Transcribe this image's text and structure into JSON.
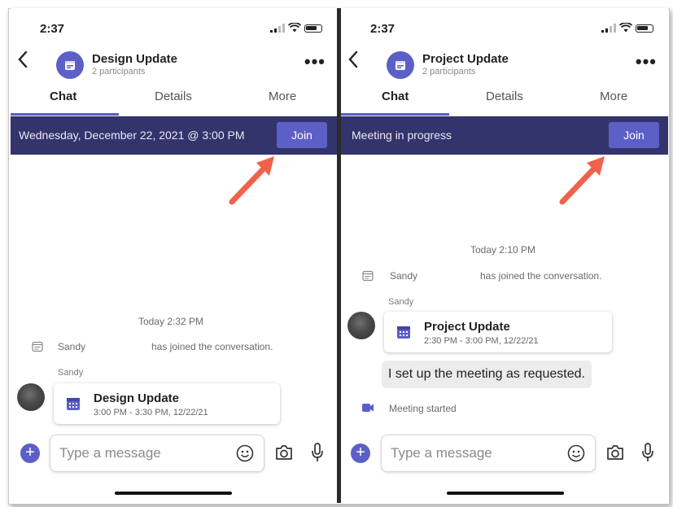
{
  "screens": [
    {
      "status_time": "2:37",
      "chat_title": "Design Update",
      "participants": "2 participants",
      "tabs": [
        "Chat",
        "Details",
        "More"
      ],
      "banner_text": "Wednesday, December 22, 2021 @ 3:00 PM",
      "join_label": "Join",
      "timestamp": "Today 2:32 PM",
      "system_message": {
        "name": "Sandy",
        "text": "has joined the conversation."
      },
      "sender_name": "Sandy",
      "meeting_card": {
        "title": "Design Update",
        "time": "3:00 PM - 3:30 PM, 12/22/21"
      },
      "composer_placeholder": "Type a message"
    },
    {
      "status_time": "2:37",
      "chat_title": "Project Update",
      "participants": "2 participants",
      "tabs": [
        "Chat",
        "Details",
        "More"
      ],
      "banner_text": "Meeting in progress",
      "join_label": "Join",
      "timestamp": "Today 2:10 PM",
      "system_message": {
        "name": "Sandy",
        "text": "has joined the conversation."
      },
      "sender_name": "Sandy",
      "meeting_card": {
        "title": "Project Update",
        "time": "2:30 PM - 3:00 PM, 12/22/21"
      },
      "message_bubble": "I set up the meeting as requested.",
      "meeting_started": "Meeting started",
      "composer_placeholder": "Type a message"
    }
  ],
  "colors": {
    "accent": "#5c5fc6",
    "banner": "#33346b",
    "arrow": "#f0624b"
  },
  "icons": [
    "back-chevron-icon",
    "calendar-icon",
    "more-dots-icon",
    "emoji-icon",
    "camera-icon",
    "microphone-icon",
    "plus-icon",
    "video-icon"
  ]
}
